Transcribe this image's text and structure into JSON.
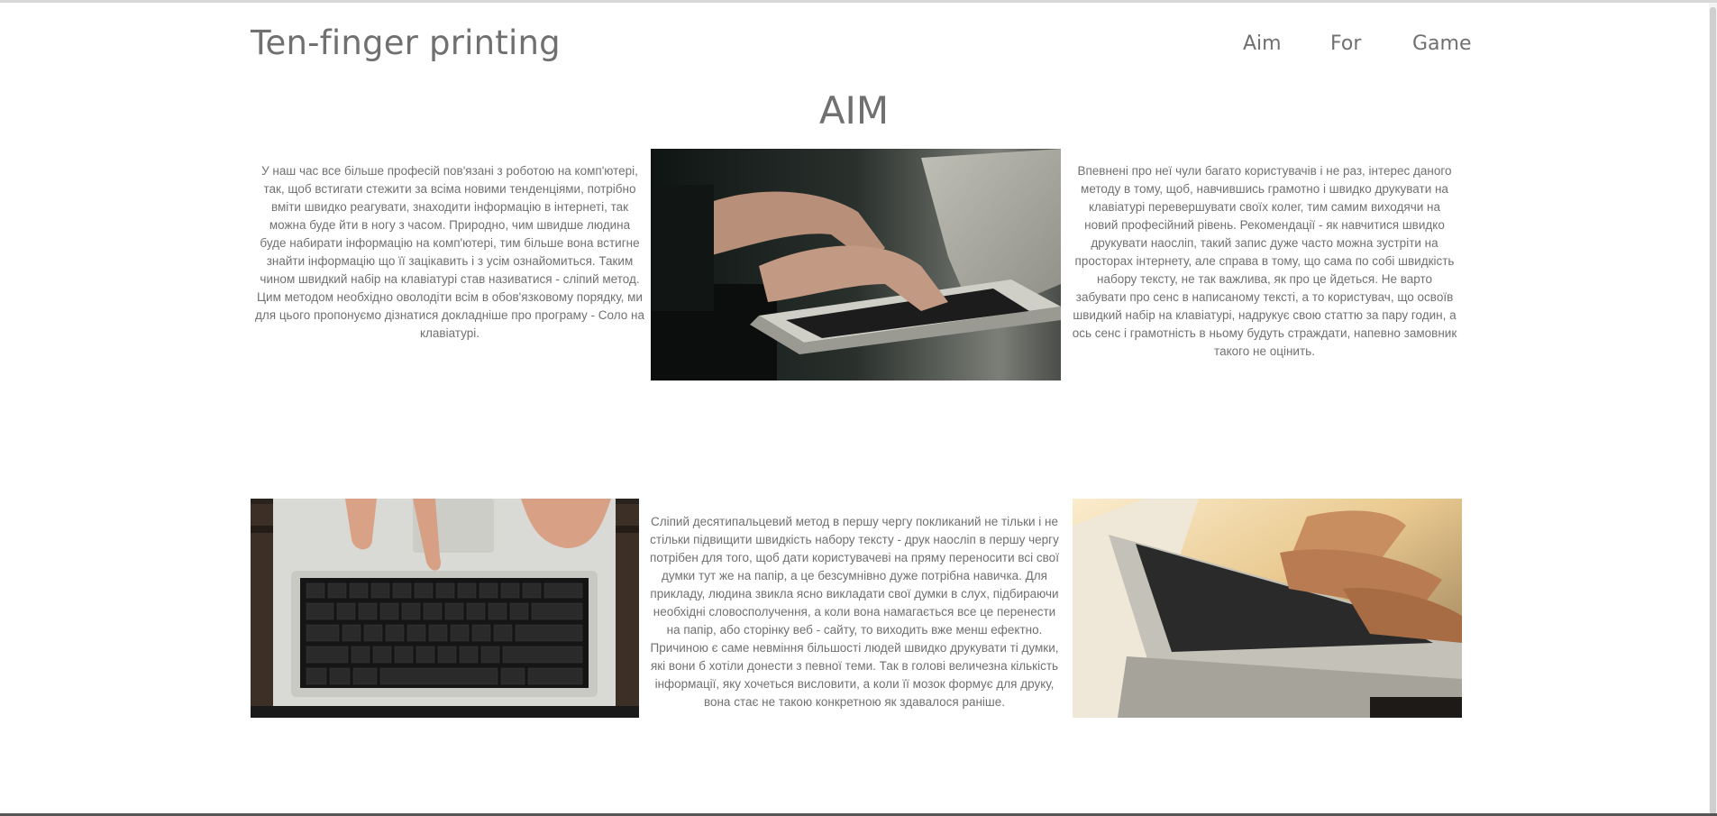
{
  "header": {
    "site_title": "Ten-finger printing",
    "nav": [
      "Aim",
      "For",
      "Game"
    ]
  },
  "aim_section": {
    "heading": "AIM",
    "paragraph_left": "У наш час все більше професій пов'язані з роботою на комп'ютері, так, щоб встигати стежити за всіма новими тенденціями, потрібно вміти швидко реагувати, знаходити інформацію в інтернеті, так можна буде йти в ногу з часом. Природно, чим швидше людина буде набирати інформацію на комп'ютері, тим більше вона встигне знайти інформацію що її зацікавить і з усім ознайомиться. Таким чином швидкий набір на клавіатурі став називатися - сліпий метод. Цим методом необхідно оволодіти всім в обов'язковому порядку, ми для цього пропонуємо дізнатися докладніше про програму - Соло на клавіатурі.",
    "paragraph_right": "Впевнені про неї чули багато користувачів і не раз, інтерес даного методу в тому, щоб, навчившись грамотно і швидко друкувати на клавіатурі перевершувати своїх колег, тим самим виходячи на новий професійний рівень. Рекомендації - як навчитися швидко друкувати наосліп, такий запис дуже часто можна зустріти на просторах інтернету, але справа в тому, що сама по собі швидкість набору тексту, не так важлива, як про це йдеться. Не варто забувати про сенс в написаному тексті, а то користувач, що освоїв швидкий набір на клавіатурі, надрукує свою статтю за пару годин, а ось сенс і грамотність в ньому будуть страждати, напевно замовник такого не оцінить.",
    "paragraph_middle": "Сліпий десятипальцевий метод в першу чергу покликаний не тільки і не стільки підвищити швидкість набору тексту - друк наосліп в першу чергу потрібен для того, щоб дати користувачеві на пряму переносити всі свої думки тут же на папір, а це безсумнівно дуже потрібна навичка. Для прикладу, людина звикла ясно викладати свої думки в слух, підбираючи необхідні словосполучення, а коли вона намагається все це перенести на папір, або сторінку веб - сайту, то виходить вже менш ефектно. Причиною є саме невміння більшості людей швидко друкувати ті думки, які вони б хотіли донести з певної теми. Так в голові величезна кількість інформації, яку хочеться висловити, а коли її мозок формує для друку, вона стає не такою конкретною як здавалося раніше."
  },
  "colors": {
    "text": "#707070",
    "background": "#ffffff"
  }
}
